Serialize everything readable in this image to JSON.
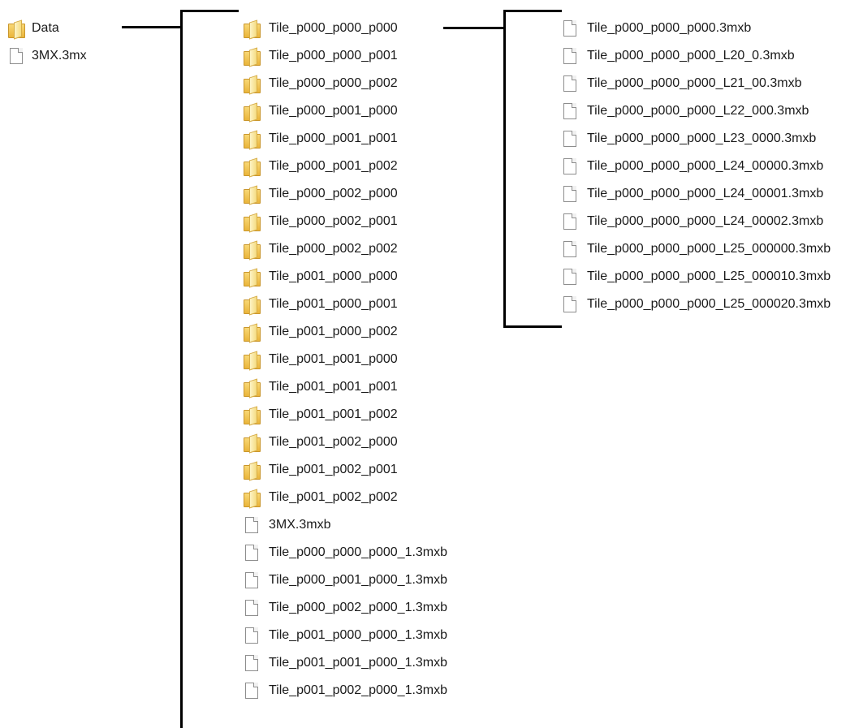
{
  "root": [
    {
      "type": "folder",
      "name": "Data"
    },
    {
      "type": "file",
      "name": "3MX.3mx"
    }
  ],
  "data_folder": [
    {
      "type": "folder",
      "name": "Tile_p000_p000_p000"
    },
    {
      "type": "folder",
      "name": "Tile_p000_p000_p001"
    },
    {
      "type": "folder",
      "name": "Tile_p000_p000_p002"
    },
    {
      "type": "folder",
      "name": "Tile_p000_p001_p000"
    },
    {
      "type": "folder",
      "name": "Tile_p000_p001_p001"
    },
    {
      "type": "folder",
      "name": "Tile_p000_p001_p002"
    },
    {
      "type": "folder",
      "name": "Tile_p000_p002_p000"
    },
    {
      "type": "folder",
      "name": "Tile_p000_p002_p001"
    },
    {
      "type": "folder",
      "name": "Tile_p000_p002_p002"
    },
    {
      "type": "folder",
      "name": "Tile_p001_p000_p000"
    },
    {
      "type": "folder",
      "name": "Tile_p001_p000_p001"
    },
    {
      "type": "folder",
      "name": "Tile_p001_p000_p002"
    },
    {
      "type": "folder",
      "name": "Tile_p001_p001_p000"
    },
    {
      "type": "folder",
      "name": "Tile_p001_p001_p001"
    },
    {
      "type": "folder",
      "name": "Tile_p001_p001_p002"
    },
    {
      "type": "folder",
      "name": "Tile_p001_p002_p000"
    },
    {
      "type": "folder",
      "name": "Tile_p001_p002_p001"
    },
    {
      "type": "folder",
      "name": "Tile_p001_p002_p002"
    },
    {
      "type": "file",
      "name": "3MX.3mxb"
    },
    {
      "type": "file",
      "name": "Tile_p000_p000_p000_1.3mxb"
    },
    {
      "type": "file",
      "name": "Tile_p000_p001_p000_1.3mxb"
    },
    {
      "type": "file",
      "name": "Tile_p000_p002_p000_1.3mxb"
    },
    {
      "type": "file",
      "name": "Tile_p001_p000_p000_1.3mxb"
    },
    {
      "type": "file",
      "name": "Tile_p001_p001_p000_1.3mxb"
    },
    {
      "type": "file",
      "name": "Tile_p001_p002_p000_1.3mxb"
    }
  ],
  "tile_folder": [
    {
      "type": "file",
      "name": "Tile_p000_p000_p000.3mxb"
    },
    {
      "type": "file",
      "name": "Tile_p000_p000_p000_L20_0.3mxb"
    },
    {
      "type": "file",
      "name": "Tile_p000_p000_p000_L21_00.3mxb"
    },
    {
      "type": "file",
      "name": "Tile_p000_p000_p000_L22_000.3mxb"
    },
    {
      "type": "file",
      "name": "Tile_p000_p000_p000_L23_0000.3mxb"
    },
    {
      "type": "file",
      "name": "Tile_p000_p000_p000_L24_00000.3mxb"
    },
    {
      "type": "file",
      "name": "Tile_p000_p000_p000_L24_00001.3mxb"
    },
    {
      "type": "file",
      "name": "Tile_p000_p000_p000_L24_00002.3mxb"
    },
    {
      "type": "file",
      "name": "Tile_p000_p000_p000_L25_000000.3mxb"
    },
    {
      "type": "file",
      "name": "Tile_p000_p000_p000_L25_000010.3mxb"
    },
    {
      "type": "file",
      "name": "Tile_p000_p000_p000_L25_000020.3mxb"
    }
  ]
}
